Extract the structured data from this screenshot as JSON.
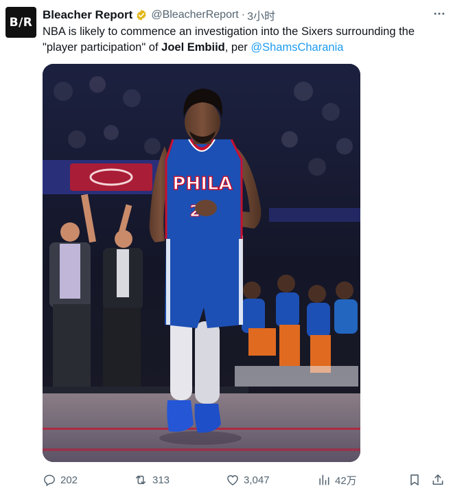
{
  "tweet": {
    "author": {
      "display_name": "Bleacher Report",
      "handle": "@BleacherReport",
      "avatar_text": "B/R"
    },
    "separator": "·",
    "time": "3小时",
    "text": {
      "part1": "NBA is likely to commence an investigation into the Sixers surrounding the \"player participation\" of ",
      "bold": "Joel Embiid",
      "part2": ", per ",
      "mention": "@ShamsCharania"
    },
    "media": {
      "jersey_text": "PHILA",
      "jersey_number": "2"
    },
    "actions": {
      "replies": "202",
      "retweets": "313",
      "likes": "3,047",
      "views": "42万"
    }
  },
  "icons": {
    "verified": "verified-badge-icon",
    "more": "more-dots-icon",
    "reply": "reply-icon",
    "retweet": "retweet-icon",
    "like": "heart-icon",
    "views": "views-chart-icon",
    "bookmark": "bookmark-icon",
    "share": "share-icon"
  },
  "colors": {
    "text": "#0f1419",
    "secondary": "#536471",
    "link": "#1d9bf0",
    "verified_gold": "#e2b719",
    "jersey_blue": "#1d50b4",
    "accent_red": "#c8102e"
  }
}
